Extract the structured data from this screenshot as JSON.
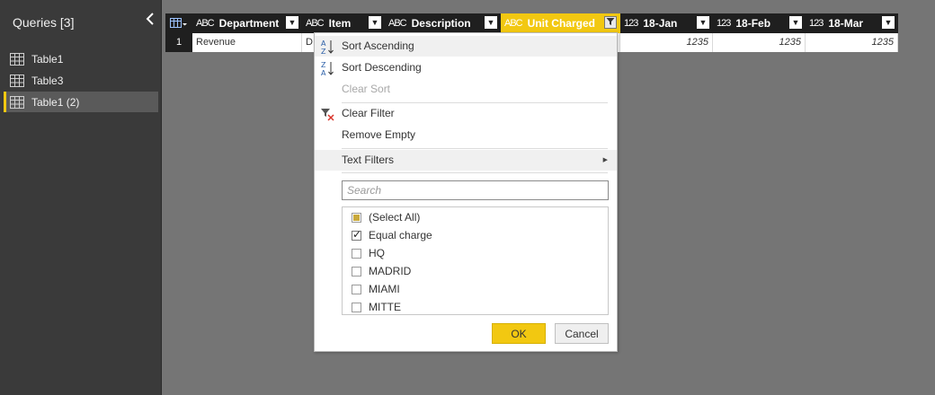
{
  "queries": {
    "title": "Queries [3]",
    "collapse_glyph": "<",
    "items": [
      {
        "label": "Table1"
      },
      {
        "label": "Table3"
      },
      {
        "label": "Table1 (2)"
      }
    ]
  },
  "grid": {
    "columns": [
      {
        "type": "ABC",
        "name": "Department"
      },
      {
        "type": "ABC",
        "name": "Item"
      },
      {
        "type": "ABC",
        "name": "Description"
      },
      {
        "type": "ABC",
        "name": "Unit Charged"
      },
      {
        "type": "123",
        "name": "18-Jan"
      },
      {
        "type": "123",
        "name": "18-Feb"
      },
      {
        "type": "123",
        "name": "18-Mar"
      }
    ],
    "row": {
      "number": "1",
      "department": "Revenue",
      "item": "D",
      "jan": "1235",
      "feb": "1235",
      "mar": "1235"
    }
  },
  "filter_menu": {
    "sort_ascending": "Sort Ascending",
    "sort_descending": "Sort Descending",
    "clear_sort": "Clear Sort",
    "clear_filter": "Clear Filter",
    "remove_empty": "Remove Empty",
    "text_filters": "Text Filters",
    "search_placeholder": "Search",
    "values": [
      {
        "label": "(Select All)",
        "state": "partial"
      },
      {
        "label": "Equal charge",
        "state": "checked"
      },
      {
        "label": "HQ",
        "state": "unchecked"
      },
      {
        "label": "MADRID",
        "state": "unchecked"
      },
      {
        "label": "MIAMI",
        "state": "unchecked"
      },
      {
        "label": "MITTE",
        "state": "unchecked"
      }
    ],
    "ok_label": "OK",
    "cancel_label": "Cancel"
  },
  "colors": {
    "accent": "#f2c811",
    "pane_bg": "#3a3a3a",
    "canvas_bg": "#757575",
    "header_bg": "#1f1f1f"
  }
}
